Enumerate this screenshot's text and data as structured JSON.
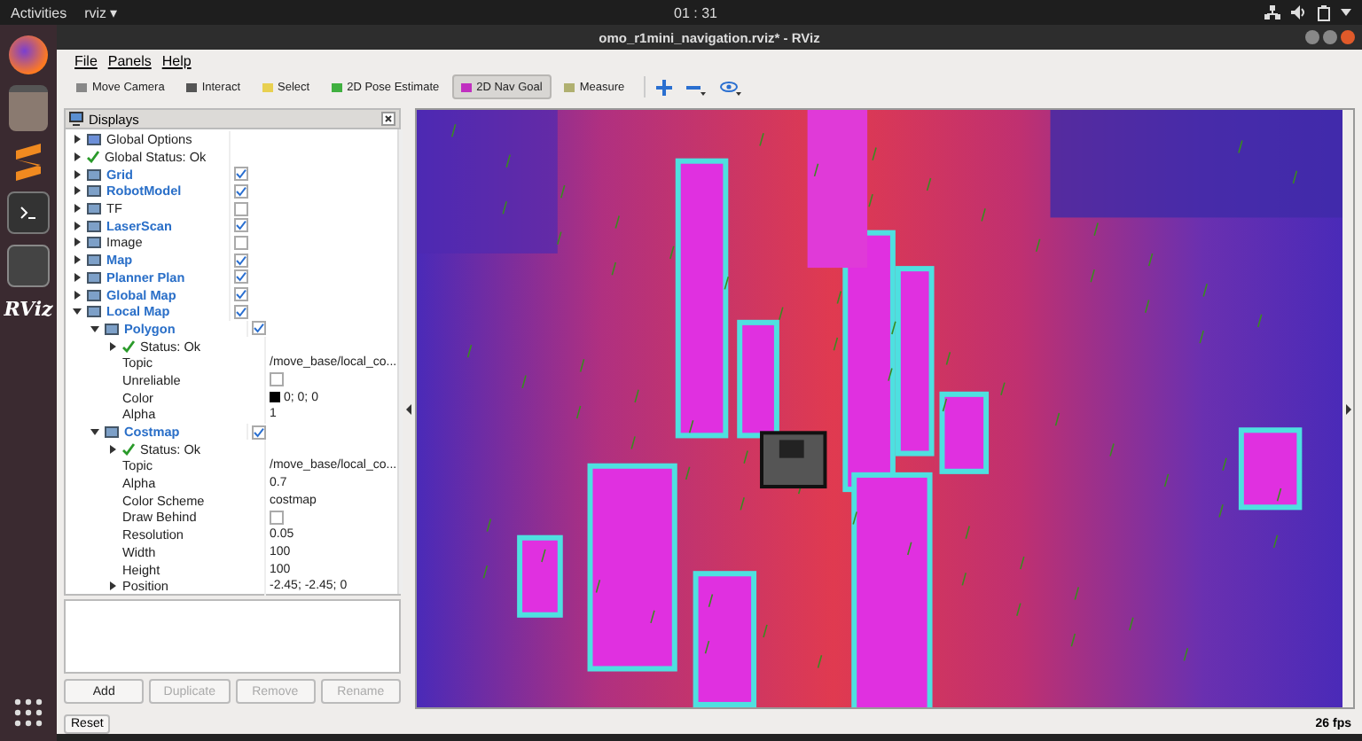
{
  "top_bar": {
    "activities": "Activities",
    "app_menu": "rviz ▾",
    "clock": "01 : 31"
  },
  "dock": {
    "rviz_label": "RViz"
  },
  "window": {
    "title": "omo_r1mini_navigation.rviz* - RViz"
  },
  "menu": [
    "File",
    "Panels",
    "Help"
  ],
  "tools": [
    {
      "label": "Move Camera",
      "selected": false
    },
    {
      "label": "Interact",
      "selected": false
    },
    {
      "label": "Select",
      "selected": false
    },
    {
      "label": "2D Pose Estimate",
      "selected": false
    },
    {
      "label": "2D Nav Goal",
      "selected": true
    },
    {
      "label": "Measure",
      "selected": false
    }
  ],
  "displays": {
    "title": "Displays",
    "tree": [
      {
        "label": "Global Options",
        "kind": "display",
        "expanded": false
      },
      {
        "label": "Global Status: Ok",
        "kind": "status",
        "expanded": false
      },
      {
        "label": "Grid",
        "kind": "display",
        "expanded": false,
        "checked": true
      },
      {
        "label": "RobotModel",
        "kind": "display",
        "expanded": false,
        "checked": true
      },
      {
        "label": "TF",
        "kind": "display",
        "expanded": false,
        "checked": false
      },
      {
        "label": "LaserScan",
        "kind": "display",
        "expanded": false,
        "checked": true
      },
      {
        "label": "Image",
        "kind": "display",
        "expanded": false,
        "checked": false
      },
      {
        "label": "Map",
        "kind": "display",
        "expanded": false,
        "checked": true
      },
      {
        "label": "Planner Plan",
        "kind": "display",
        "expanded": false,
        "checked": true
      },
      {
        "label": "Global Map",
        "kind": "display",
        "expanded": false,
        "checked": true
      },
      {
        "label": "Local Map",
        "kind": "display",
        "expanded": true,
        "checked": true,
        "children": [
          {
            "label": "Polygon",
            "kind": "display",
            "expanded": true,
            "checked": true,
            "children": [
              {
                "label": "Status: Ok",
                "kind": "status",
                "expanded": false
              },
              {
                "label": "Topic",
                "kind": "property",
                "value": "/move_base/local_co..."
              },
              {
                "label": "Unreliable",
                "kind": "property",
                "checked": false
              },
              {
                "label": "Color",
                "kind": "property",
                "value": "0; 0; 0",
                "color": "#000000"
              },
              {
                "label": "Alpha",
                "kind": "property",
                "value": "1"
              }
            ]
          },
          {
            "label": "Costmap",
            "kind": "display",
            "expanded": true,
            "checked": true,
            "children": [
              {
                "label": "Status: Ok",
                "kind": "status",
                "expanded": false
              },
              {
                "label": "Topic",
                "kind": "property",
                "value": "/move_base/local_co..."
              },
              {
                "label": "Alpha",
                "kind": "property",
                "value": "0.7"
              },
              {
                "label": "Color Scheme",
                "kind": "property",
                "value": "costmap"
              },
              {
                "label": "Draw Behind",
                "kind": "property",
                "checked": false
              },
              {
                "label": "Resolution",
                "kind": "property",
                "value": "0.05"
              },
              {
                "label": "Width",
                "kind": "property",
                "value": "100"
              },
              {
                "label": "Height",
                "kind": "property",
                "value": "100"
              },
              {
                "label": "Position",
                "kind": "property",
                "expanded": false,
                "value": "-2.45; -2.45; 0"
              }
            ]
          }
        ]
      }
    ],
    "buttons": [
      {
        "label": "Add",
        "disabled": false
      },
      {
        "label": "Duplicate",
        "disabled": true
      },
      {
        "label": "Remove",
        "disabled": true
      },
      {
        "label": "Rename",
        "disabled": true
      }
    ]
  },
  "reset": "Reset",
  "fps": "26 fps"
}
